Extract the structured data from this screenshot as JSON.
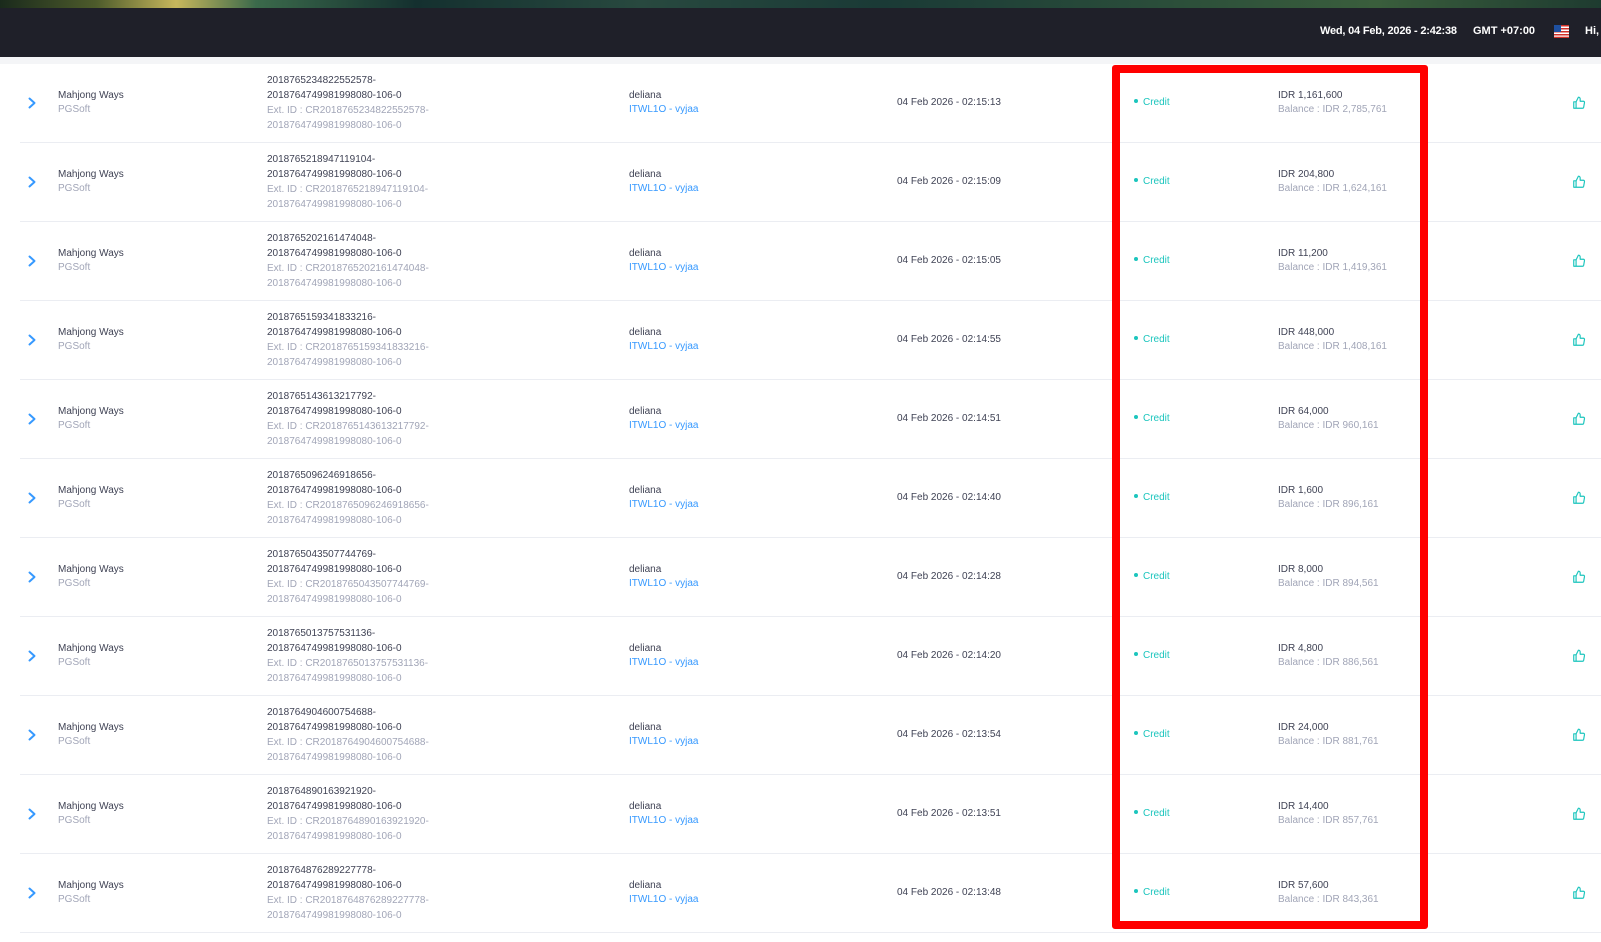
{
  "header": {
    "datetime": "Wed, 04 Feb, 2026 - 2:42:38",
    "timezone": "GMT +07:00",
    "greeting": "Hi,",
    "flag_icon": "us-flag-icon"
  },
  "colors": {
    "topbar": "#1f2029",
    "status_credit": "#1bc5bd",
    "link": "#3699ff",
    "highlight": "#ff0000"
  },
  "rows": [
    {
      "game": "Mahjong Ways",
      "provider": "PGSoft",
      "tx_line1": "2018765234822552578-",
      "tx_line2": "2018764749981998080-106-0",
      "ext_line1": "Ext. ID : CR2018765234822552578-",
      "ext_line2": "2018764749981998080-106-0",
      "user": "deliana",
      "account": "ITWL1O - vyjaa",
      "time": "04 Feb 2026 - 02:15:13",
      "status": "Credit",
      "amount": "IDR 1,161,600",
      "balance": "Balance : IDR 2,785,761"
    },
    {
      "game": "Mahjong Ways",
      "provider": "PGSoft",
      "tx_line1": "2018765218947119104-",
      "tx_line2": "2018764749981998080-106-0",
      "ext_line1": "Ext. ID : CR2018765218947119104-",
      "ext_line2": "2018764749981998080-106-0",
      "user": "deliana",
      "account": "ITWL1O - vyjaa",
      "time": "04 Feb 2026 - 02:15:09",
      "status": "Credit",
      "amount": "IDR 204,800",
      "balance": "Balance : IDR 1,624,161"
    },
    {
      "game": "Mahjong Ways",
      "provider": "PGSoft",
      "tx_line1": "2018765202161474048-",
      "tx_line2": "2018764749981998080-106-0",
      "ext_line1": "Ext. ID : CR2018765202161474048-",
      "ext_line2": "2018764749981998080-106-0",
      "user": "deliana",
      "account": "ITWL1O - vyjaa",
      "time": "04 Feb 2026 - 02:15:05",
      "status": "Credit",
      "amount": "IDR 11,200",
      "balance": "Balance : IDR 1,419,361"
    },
    {
      "game": "Mahjong Ways",
      "provider": "PGSoft",
      "tx_line1": "2018765159341833216-",
      "tx_line2": "2018764749981998080-106-0",
      "ext_line1": "Ext. ID : CR2018765159341833216-",
      "ext_line2": "2018764749981998080-106-0",
      "user": "deliana",
      "account": "ITWL1O - vyjaa",
      "time": "04 Feb 2026 - 02:14:55",
      "status": "Credit",
      "amount": "IDR 448,000",
      "balance": "Balance : IDR 1,408,161"
    },
    {
      "game": "Mahjong Ways",
      "provider": "PGSoft",
      "tx_line1": "2018765143613217792-",
      "tx_line2": "2018764749981998080-106-0",
      "ext_line1": "Ext. ID : CR2018765143613217792-",
      "ext_line2": "2018764749981998080-106-0",
      "user": "deliana",
      "account": "ITWL1O - vyjaa",
      "time": "04 Feb 2026 - 02:14:51",
      "status": "Credit",
      "amount": "IDR 64,000",
      "balance": "Balance : IDR 960,161"
    },
    {
      "game": "Mahjong Ways",
      "provider": "PGSoft",
      "tx_line1": "2018765096246918656-",
      "tx_line2": "2018764749981998080-106-0",
      "ext_line1": "Ext. ID : CR2018765096246918656-",
      "ext_line2": "2018764749981998080-106-0",
      "user": "deliana",
      "account": "ITWL1O - vyjaa",
      "time": "04 Feb 2026 - 02:14:40",
      "status": "Credit",
      "amount": "IDR 1,600",
      "balance": "Balance : IDR 896,161"
    },
    {
      "game": "Mahjong Ways",
      "provider": "PGSoft",
      "tx_line1": "2018765043507744769-",
      "tx_line2": "2018764749981998080-106-0",
      "ext_line1": "Ext. ID : CR2018765043507744769-",
      "ext_line2": "2018764749981998080-106-0",
      "user": "deliana",
      "account": "ITWL1O - vyjaa",
      "time": "04 Feb 2026 - 02:14:28",
      "status": "Credit",
      "amount": "IDR 8,000",
      "balance": "Balance : IDR 894,561"
    },
    {
      "game": "Mahjong Ways",
      "provider": "PGSoft",
      "tx_line1": "2018765013757531136-",
      "tx_line2": "2018764749981998080-106-0",
      "ext_line1": "Ext. ID : CR2018765013757531136-",
      "ext_line2": "2018764749981998080-106-0",
      "user": "deliana",
      "account": "ITWL1O - vyjaa",
      "time": "04 Feb 2026 - 02:14:20",
      "status": "Credit",
      "amount": "IDR 4,800",
      "balance": "Balance : IDR 886,561"
    },
    {
      "game": "Mahjong Ways",
      "provider": "PGSoft",
      "tx_line1": "2018764904600754688-",
      "tx_line2": "2018764749981998080-106-0",
      "ext_line1": "Ext. ID : CR2018764904600754688-",
      "ext_line2": "2018764749981998080-106-0",
      "user": "deliana",
      "account": "ITWL1O - vyjaa",
      "time": "04 Feb 2026 - 02:13:54",
      "status": "Credit",
      "amount": "IDR 24,000",
      "balance": "Balance : IDR 881,761"
    },
    {
      "game": "Mahjong Ways",
      "provider": "PGSoft",
      "tx_line1": "2018764890163921920-",
      "tx_line2": "2018764749981998080-106-0",
      "ext_line1": "Ext. ID : CR2018764890163921920-",
      "ext_line2": "2018764749981998080-106-0",
      "user": "deliana",
      "account": "ITWL1O - vyjaa",
      "time": "04 Feb 2026 - 02:13:51",
      "status": "Credit",
      "amount": "IDR 14,400",
      "balance": "Balance : IDR 857,761"
    },
    {
      "game": "Mahjong Ways",
      "provider": "PGSoft",
      "tx_line1": "2018764876289227778-",
      "tx_line2": "2018764749981998080-106-0",
      "ext_line1": "Ext. ID : CR2018764876289227778-",
      "ext_line2": "2018764749981998080-106-0",
      "user": "deliana",
      "account": "ITWL1O - vyjaa",
      "time": "04 Feb 2026 - 02:13:48",
      "status": "Credit",
      "amount": "IDR 57,600",
      "balance": "Balance : IDR 843,361"
    }
  ]
}
